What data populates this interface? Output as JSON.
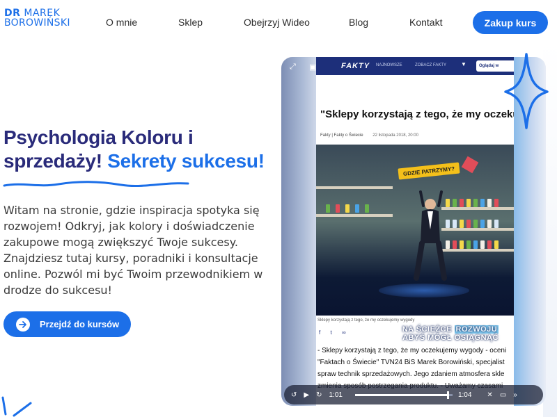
{
  "nav": {
    "logo_line1_bold": "DR",
    "logo_line1_rest": "MAREK",
    "logo_line2": "BOROWIŃSKI",
    "links": [
      "O mnie",
      "Sklep",
      "Obejrzyj Wideo",
      "Blog",
      "Kontakt"
    ],
    "cta": "Zakup kurs"
  },
  "hero": {
    "title_part1": "Psychologia Koloru i sprzedaży!",
    "title_part2": "Sekrety sukcesu!",
    "text": "Witam na stronie, gdzie inspiracja spotyka się rozwojem! Odkryj, jak kolory i doświadczenie zakupowe mogą zwiększyć Twoje sukcesy. Znajdziesz tutaj kursy, poradniki i konsultacje online. Pozwól mi być Twoim przewodnikiem w drodze do sukcesu!",
    "cta": "Przejdź do kursów"
  },
  "video": {
    "site_logo": "FAKTY",
    "site_nav": [
      "NAJNOWSZE",
      "ZOBACZ FAKTY"
    ],
    "watch_label": "Oglądaj w",
    "article_title": "\"Sklepy korzystają z tego, że my oczeku",
    "article_source": "Fakty | Fakty o Świecie",
    "article_date": "22 listopada 2018, 20:00",
    "sign_text": "GDZIE PATRZYMY?",
    "image_caption": "Sklepy korzystają z tego, że my oczekujemy wygody",
    "overlay_line1": "NA ŚCIEŻCE",
    "overlay_highlight": "ROZWOJU",
    "overlay_line2": "ABYŚ MÓGŁ OSIĄGNĄĆ",
    "body_lines": [
      "- Sklepy korzystają z tego, że my oczekujemy wygody - oceni",
      "\"Faktach o Świecie\" TVN24 BiS Marek Borowiński, specjalist",
      "spraw technik sprzedażowych. Jego zdaniem atmosfera skle",
      "zmienia sposób postrzegania produktu. - Uważamy czasami"
    ],
    "time_current": "1:01",
    "time_total": "1:04",
    "progress": 0.95,
    "icons": [
      "expand-icon",
      "pip-icon",
      "rewind-icon",
      "play-icon",
      "forward-icon",
      "mute-icon",
      "cast-icon",
      "next-icon"
    ]
  },
  "colors": {
    "brand_blue": "#1c6fe8",
    "title_navy": "#2a2b7a",
    "fakty_navy": "#1d2f7a"
  }
}
